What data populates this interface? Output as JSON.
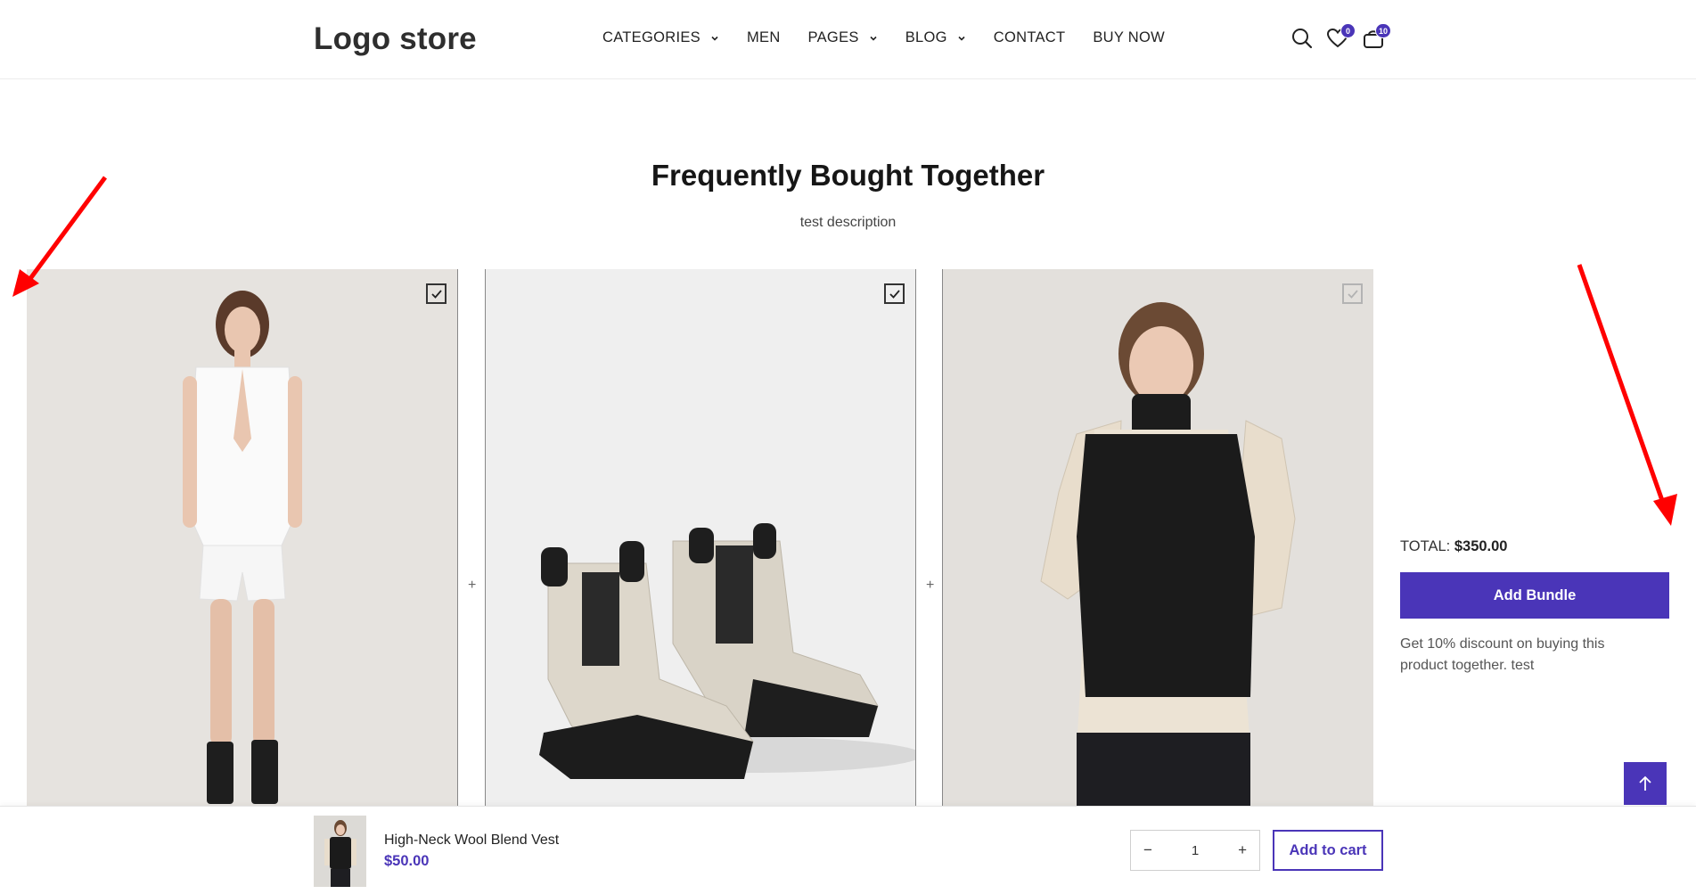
{
  "header": {
    "logo": "Logo store",
    "nav": [
      {
        "label": "CATEGORIES",
        "has_dropdown": true
      },
      {
        "label": "MEN",
        "has_dropdown": false
      },
      {
        "label": "PAGES",
        "has_dropdown": true
      },
      {
        "label": "BLOG",
        "has_dropdown": true
      },
      {
        "label": "CONTACT",
        "has_dropdown": false
      },
      {
        "label": "BUY NOW",
        "has_dropdown": false
      }
    ],
    "wishlist_count": "0",
    "cart_count": "10",
    "icons": [
      "search-icon",
      "heart-icon",
      "bag-icon"
    ]
  },
  "section": {
    "title": "Frequently Bought Together",
    "description": "test description"
  },
  "products": [
    {
      "image": "model in white sleeveless blazer and shorts",
      "checked": true
    },
    {
      "image": "beige chelsea rain boots",
      "checked": true
    },
    {
      "image": "model in black turtleneck knit vest",
      "checked": true,
      "disabled": true
    }
  ],
  "bundle": {
    "total_label": "TOTAL:",
    "total_value": "$350.00",
    "button_label": "Add Bundle",
    "note": "Get 10% discount on buying this product together. test"
  },
  "sticky_bar": {
    "product_name": "High-Neck Wool Blend Vest",
    "price": "$50.00",
    "quantity": "1",
    "minus": "−",
    "plus": "+",
    "add_to_cart": "Add to cart"
  },
  "separator": "+",
  "colors": {
    "accent": "#4a35b8",
    "annotation": "#ff0000"
  }
}
